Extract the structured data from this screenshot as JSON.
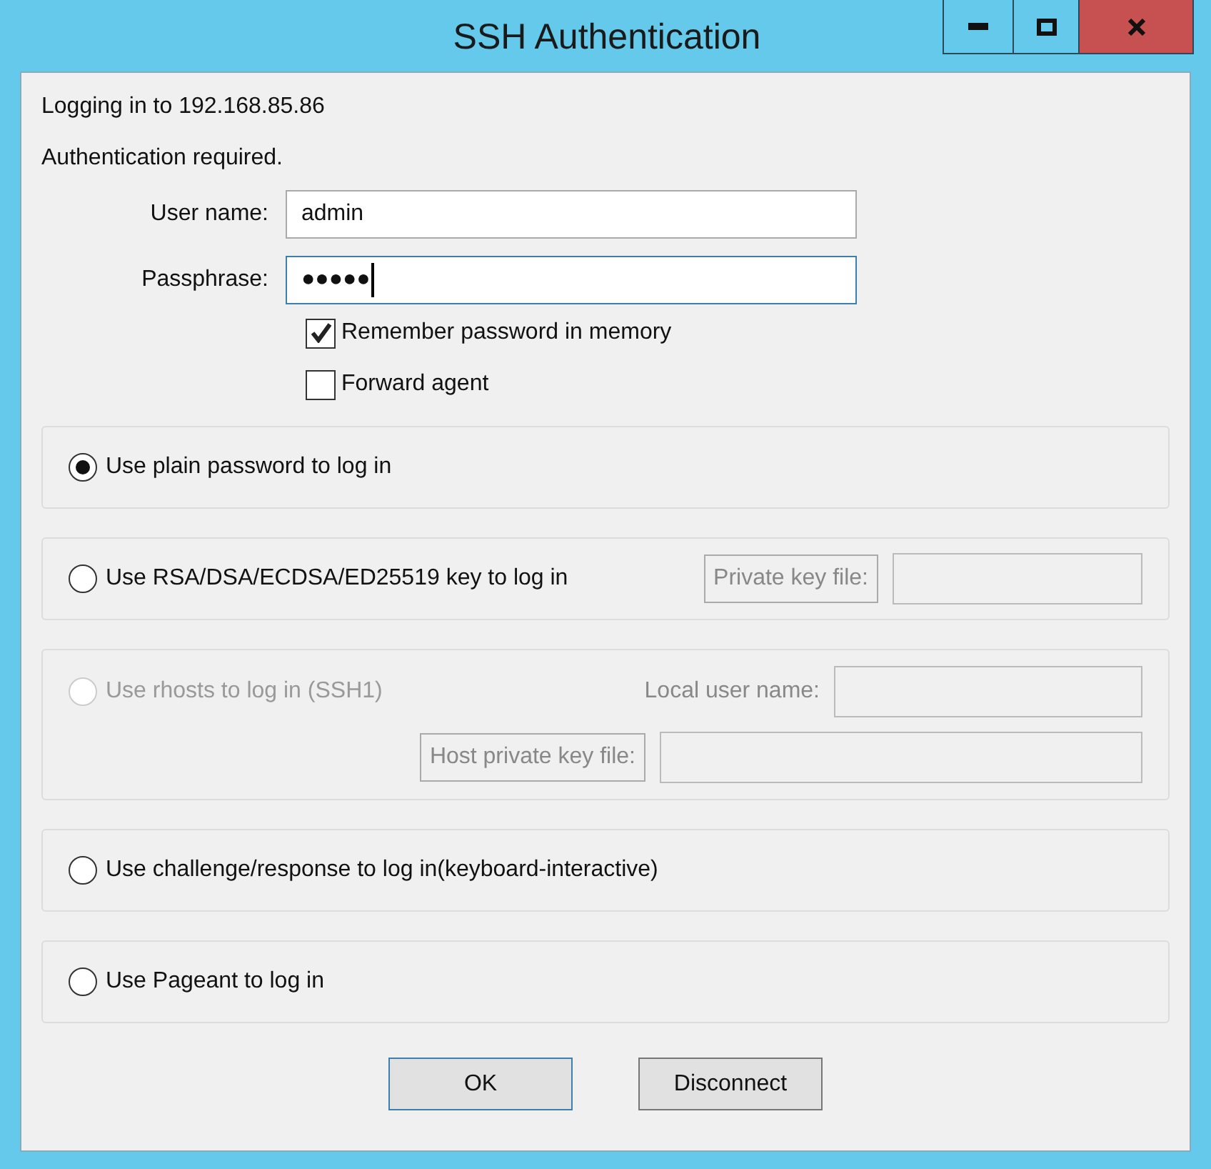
{
  "window": {
    "title": "SSH Authentication"
  },
  "info": [
    "Logging in to 192.168.85.86",
    "Authentication required."
  ],
  "fields": [
    {
      "label": "User name:",
      "value": "admin",
      "focused": false
    },
    {
      "label": "Passphrase:",
      "value": "●●●●●",
      "focused": true
    }
  ],
  "checkboxes": [
    {
      "label": "Remember password in memory",
      "checked": true
    },
    {
      "label": "Forward agent",
      "checked": false
    }
  ],
  "methods": [
    {
      "label": "Use plain password to log in",
      "selected": true,
      "disabled": false
    },
    {
      "label": "Use RSA/DSA/ECDSA/ED25519 key to log in",
      "selected": false,
      "disabled": false,
      "fields": [
        {
          "label": "Private key file:",
          "boxed": true
        }
      ]
    },
    {
      "label": "Use rhosts to log in (SSH1)",
      "selected": false,
      "disabled": true,
      "fields": [
        {
          "label": "Local user name:",
          "boxed": false
        },
        {
          "label": "Host private key file:",
          "boxed": true
        }
      ]
    },
    {
      "label": "Use challenge/response to log in(keyboard-interactive)",
      "selected": false,
      "disabled": false
    },
    {
      "label": "Use Pageant to log in",
      "selected": false,
      "disabled": false
    }
  ],
  "buttons": [
    {
      "label": "OK",
      "default": true
    },
    {
      "label": "Disconnect",
      "default": false
    }
  ]
}
